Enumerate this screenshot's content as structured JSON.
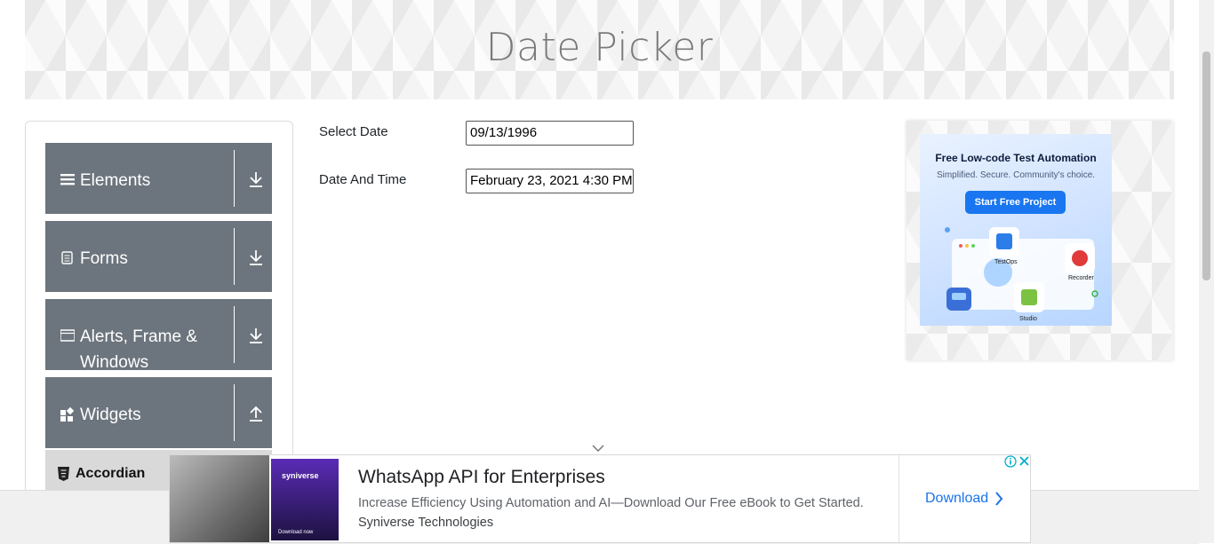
{
  "header": {
    "title": "Date Picker"
  },
  "sidebar": {
    "groups": [
      {
        "label": "Elements",
        "icon": "menu-lines-icon",
        "toggle": "download-arrow-icon"
      },
      {
        "label": "Forms",
        "icon": "document-icon",
        "toggle": "download-arrow-icon"
      },
      {
        "label": "Alerts, Frame & Windows",
        "icon": "window-icon",
        "toggle": "download-arrow-icon"
      },
      {
        "label": "Widgets",
        "icon": "widgets-grid-icon",
        "toggle": "upload-arrow-icon"
      }
    ],
    "active_item": {
      "label": "Accordian",
      "icon": "html5-shield-icon"
    }
  },
  "form": {
    "select_date": {
      "label": "Select Date",
      "value": "09/13/1996"
    },
    "date_and_time": {
      "label": "Date And Time",
      "value": "February 23, 2021 4:30 PM"
    }
  },
  "side_ad": {
    "headline": "Free Low-code Test Automation",
    "subline": "Simplified. Secure. Community's choice.",
    "cta": "Start Free Project",
    "tiles": [
      "TestOps",
      "Recorder",
      "Studio"
    ]
  },
  "bottom_ad": {
    "brand": "syniverse",
    "book_cta": "Download now",
    "title": "WhatsApp API for Enterprises",
    "description": "Increase Efficiency Using Automation and AI—Download Our Free eBook to Get Started.",
    "company": "Syniverse Technologies",
    "cta": "Download"
  },
  "colors": {
    "sidebar_group_bg": "#6c757d",
    "accent_blue": "#1a73e8",
    "ad_button": "#1976f0"
  }
}
